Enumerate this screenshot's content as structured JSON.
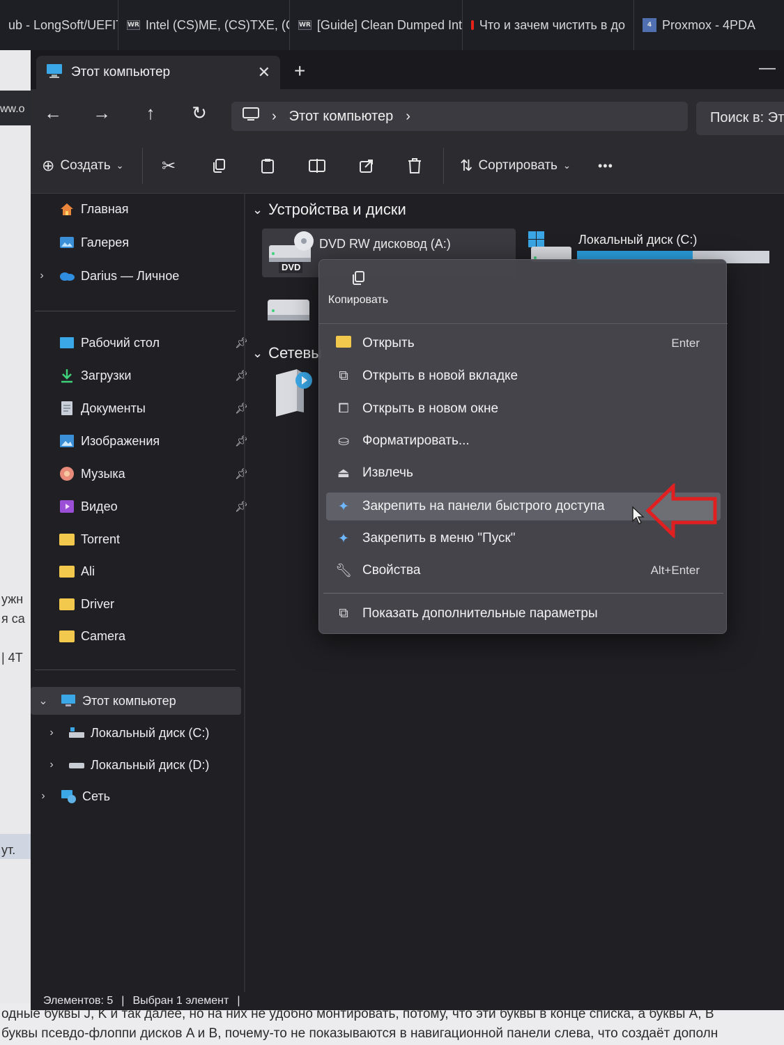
{
  "browser_tabs": [
    {
      "label": "ub - LongSoft/UEFITo",
      "icon": "github-icon"
    },
    {
      "label": "Intel (CS)ME, (CS)TXE, (CS)",
      "icon": "winraid-icon",
      "fav": "WR"
    },
    {
      "label": "[Guide] Clean Dumped Int",
      "icon": "winraid-icon",
      "fav": "WR"
    },
    {
      "label": "Что и зачем чистить в до",
      "icon": "youtube-icon"
    },
    {
      "label": "Proxmox - 4PDA",
      "icon": "4pda-icon",
      "fav": "4"
    }
  ],
  "background": {
    "left_fragments": [
      "ww.o",
      "ужн",
      "я са",
      "| 4Т",
      "ут."
    ],
    "bottom_lines": [
      "одные буквы J, K и так далее, но на них не удобно монтировать, потому, что эти буквы в конце списка, а буквы A, B",
      "буквы псевдо-флоппи дисков A и B, почему-то не показываются в навигационной панели слева, что создаёт дополн"
    ]
  },
  "window": {
    "tab_title": "Этот компьютер",
    "address": {
      "crumb": "Этот компьютер"
    },
    "search_placeholder": "Поиск в: Эт",
    "toolbar": {
      "create_label": "Создать",
      "sort_label": "Сортировать",
      "more_label": "•••"
    }
  },
  "sidebar": {
    "top": [
      {
        "label": "Главная",
        "icon": "home-icon"
      },
      {
        "label": "Галерея",
        "icon": "gallery-icon"
      },
      {
        "label": "Darius — Личное",
        "icon": "onedrive-icon"
      }
    ],
    "quick": [
      {
        "label": "Рабочий стол",
        "icon": "desktop-icon",
        "pinned": true
      },
      {
        "label": "Загрузки",
        "icon": "downloads-icon",
        "pinned": true
      },
      {
        "label": "Документы",
        "icon": "documents-icon",
        "pinned": true
      },
      {
        "label": "Изображения",
        "icon": "pictures-icon",
        "pinned": true
      },
      {
        "label": "Музыка",
        "icon": "music-icon",
        "pinned": true
      },
      {
        "label": "Видео",
        "icon": "video-icon",
        "pinned": true
      },
      {
        "label": "Torrent",
        "icon": "folder-icon"
      },
      {
        "label": "Ali",
        "icon": "folder-icon"
      },
      {
        "label": "Driver",
        "icon": "folder-icon"
      },
      {
        "label": "Camera",
        "icon": "folder-icon"
      }
    ],
    "tree": [
      {
        "label": "Этот компьютер",
        "icon": "computer-icon"
      },
      {
        "label": "Локальный диск (C:)",
        "icon": "drive-c-icon"
      },
      {
        "label": "Локальный диск (D:)",
        "icon": "drive-d-icon"
      },
      {
        "label": "Сеть",
        "icon": "network-icon"
      }
    ]
  },
  "content": {
    "section_devices": "Устройства и диски",
    "section_network": "Сетевы",
    "dvd": {
      "name": "DVD RW дисковод (A:)",
      "badge": "DVD"
    },
    "disk_c": {
      "name": "Локальный диск (C:)",
      "used_fraction": 0.6
    }
  },
  "context_menu": {
    "copy_label": "Копировать",
    "items": [
      {
        "label": "Открыть",
        "shortcut": "Enter",
        "icon": "folder-open-icon"
      },
      {
        "label": "Открыть в новой вкладке",
        "shortcut": "",
        "icon": "new-tab-icon"
      },
      {
        "label": "Открыть в новом окне",
        "shortcut": "",
        "icon": "new-window-icon"
      },
      {
        "label": "Форматировать...",
        "shortcut": "",
        "icon": "format-icon"
      },
      {
        "label": "Извлечь",
        "shortcut": "",
        "icon": "eject-icon"
      },
      {
        "label": "Закрепить на панели быстрого доступа",
        "shortcut": "",
        "icon": "pin-icon"
      },
      {
        "label": "Закрепить в меню \"Пуск\"",
        "shortcut": "",
        "icon": "pin-start-icon"
      },
      {
        "label": "Свойства",
        "shortcut": "Alt+Enter",
        "icon": "properties-icon"
      }
    ],
    "more_options": "Показать дополнительные параметры"
  },
  "status": {
    "items_count": "Элементов: 5",
    "selected": "Выбран 1 элемент"
  },
  "colors": {
    "accent": "#2ba0e0",
    "folder": "#f2c94c",
    "annotation_arrow": "#e02020"
  }
}
